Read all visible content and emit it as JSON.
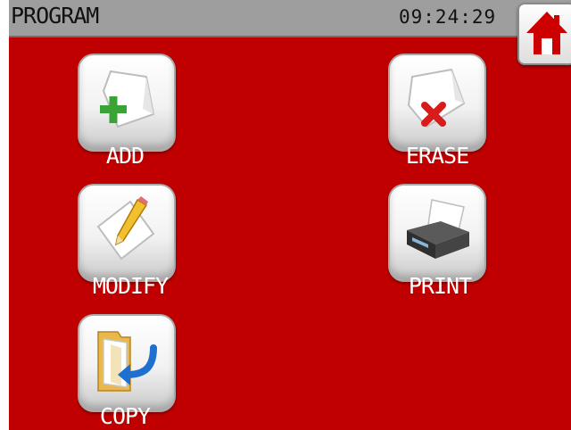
{
  "header": {
    "title": "PROGRAM",
    "time": "09:24:29",
    "home_icon": "home-icon"
  },
  "menu": [
    {
      "id": "add",
      "label": "ADD",
      "icon": "add-document-icon"
    },
    {
      "id": "erase",
      "label": "ERASE",
      "icon": "erase-document-icon"
    },
    {
      "id": "modify",
      "label": "MODIFY",
      "icon": "edit-document-icon"
    },
    {
      "id": "print",
      "label": "PRINT",
      "icon": "printer-icon"
    },
    {
      "id": "copy",
      "label": "COPY",
      "icon": "copy-folder-icon"
    }
  ],
  "colors": {
    "background": "#c00000",
    "header": "#9e9e9e",
    "home_roof": "#cc0000"
  }
}
